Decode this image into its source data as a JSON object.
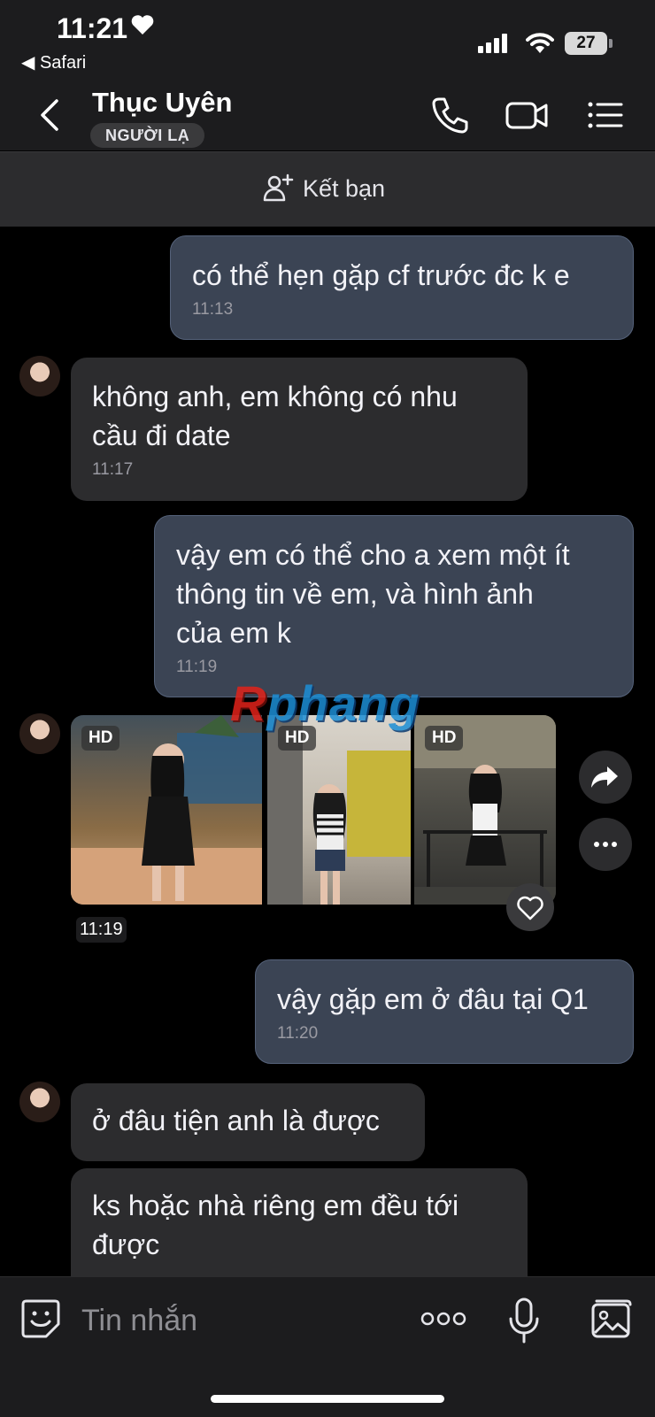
{
  "status_bar": {
    "time": "11:21",
    "back_app": "◀ Safari",
    "battery": "27"
  },
  "header": {
    "contact_name": "Thục Uyên",
    "stranger_badge": "NGƯỜI LẠ"
  },
  "friend_bar": {
    "label": "Kết bạn"
  },
  "messages": [
    {
      "direction": "out",
      "text": "có thể hẹn gặp cf trước đc k e",
      "time": "11:13"
    },
    {
      "direction": "in",
      "text": "không anh, em không có nhu\ncầu đi date",
      "time": "11:17"
    },
    {
      "direction": "out",
      "text": "vậy em có thể cho a xem một ít\nthông tin về em, và hình ảnh\ncủa em k",
      "time": "11:19"
    },
    {
      "direction": "in",
      "type": "photos",
      "badges": [
        "HD",
        "HD",
        "HD"
      ],
      "time": "11:19"
    },
    {
      "direction": "out",
      "text": "vậy gặp em ở đâu tại Q1",
      "time": "11:20"
    },
    {
      "direction": "in",
      "text": "ở đâu tiện anh là được"
    },
    {
      "direction": "in",
      "text": "ks hoặc nhà riêng em đều tới\nđược"
    }
  ],
  "watermark": {
    "part1": "R",
    "part2": "phang"
  },
  "input_bar": {
    "placeholder": "Tin nhắn"
  },
  "colors": {
    "outgoing_bubble": "#3b4454",
    "incoming_bubble": "#2c2c2e",
    "header_bg": "#1c1c1e"
  }
}
